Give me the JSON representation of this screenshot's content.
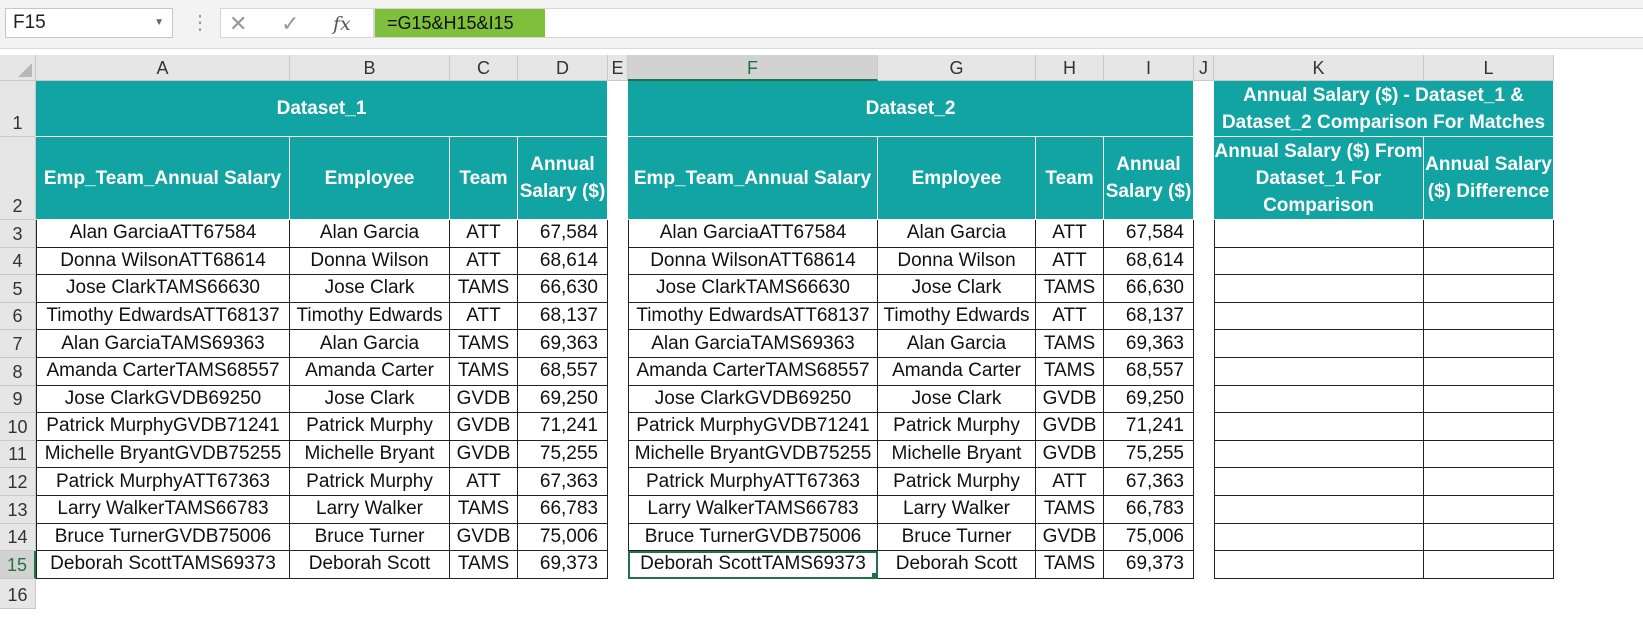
{
  "formula_bar": {
    "name_box": "F15",
    "cancel_icon": "close-icon",
    "enter_icon": "check-icon",
    "fx_label": "fx",
    "formula": "=G15&H15&I15"
  },
  "columns": [
    "A",
    "B",
    "C",
    "D",
    "E",
    "F",
    "G",
    "H",
    "I",
    "J",
    "K",
    "L"
  ],
  "rows": [
    "1",
    "2",
    "3",
    "4",
    "5",
    "6",
    "7",
    "8",
    "9",
    "10",
    "11",
    "12",
    "13",
    "14",
    "15",
    "16"
  ],
  "dataset1": {
    "title": "Dataset_1",
    "headers": [
      "Emp_Team_Annual Salary",
      "Employee",
      "Team",
      "Annual Salary ($)"
    ]
  },
  "dataset2": {
    "title": "Dataset_2",
    "headers": [
      "Emp_Team_Annual Salary",
      "Employee",
      "Team",
      "Annual Salary ($)"
    ]
  },
  "comparison": {
    "title": "Annual Salary ($) - Dataset_1 & Dataset_2 Comparison For Matches",
    "headers": [
      "Annual Salary ($) From Dataset_1 For Comparison",
      "Annual Salary ($) Difference"
    ]
  },
  "records": [
    [
      "Alan GarciaATT67584",
      "Alan Garcia",
      "ATT",
      "67,584"
    ],
    [
      "Donna WilsonATT68614",
      "Donna Wilson",
      "ATT",
      "68,614"
    ],
    [
      "Jose ClarkTAMS66630",
      "Jose Clark",
      "TAMS",
      "66,630"
    ],
    [
      "Timothy EdwardsATT68137",
      "Timothy Edwards",
      "ATT",
      "68,137"
    ],
    [
      "Alan GarciaTAMS69363",
      "Alan Garcia",
      "TAMS",
      "69,363"
    ],
    [
      "Amanda CarterTAMS68557",
      "Amanda Carter",
      "TAMS",
      "68,557"
    ],
    [
      "Jose ClarkGVDB69250",
      "Jose Clark",
      "GVDB",
      "69,250"
    ],
    [
      "Patrick MurphyGVDB71241",
      "Patrick Murphy",
      "GVDB",
      "71,241"
    ],
    [
      "Michelle BryantGVDB75255",
      "Michelle Bryant",
      "GVDB",
      "75,255"
    ],
    [
      "Patrick MurphyATT67363",
      "Patrick Murphy",
      "ATT",
      "67,363"
    ],
    [
      "Larry WalkerTAMS66783",
      "Larry Walker",
      "TAMS",
      "66,783"
    ],
    [
      "Bruce TurnerGVDB75006",
      "Bruce Turner",
      "GVDB",
      "75,006"
    ],
    [
      "Deborah ScottTAMS69373",
      "Deborah Scott",
      "TAMS",
      "69,373"
    ]
  ],
  "selected": {
    "column": "F",
    "row": "15"
  },
  "colors": {
    "header_fill": "#12a3a3",
    "formula_highlight": "#7fbf3b",
    "selection": "#217346"
  }
}
